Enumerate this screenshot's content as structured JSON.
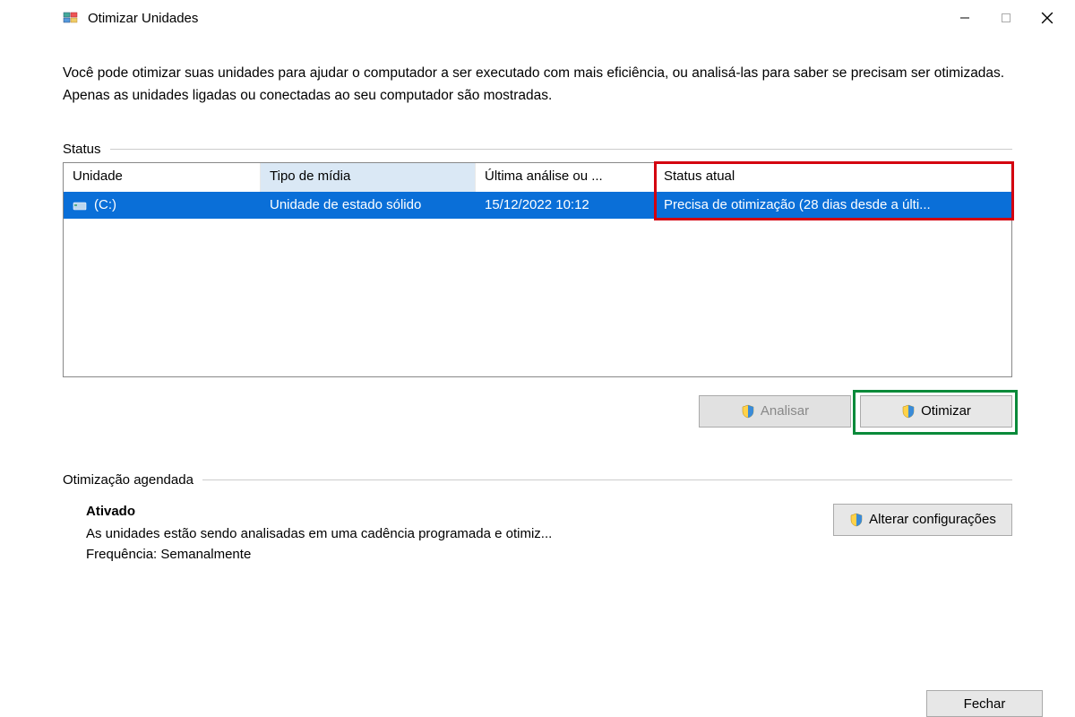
{
  "window": {
    "title": "Otimizar Unidades"
  },
  "description": "Você pode otimizar suas unidades para ajudar o computador a ser executado com mais eficiência, ou analisá-las para saber se precisam ser otimizadas. Apenas as unidades ligadas ou conectadas ao seu computador são mostradas.",
  "status_label": "Status",
  "columns": {
    "unit": "Unidade",
    "media": "Tipo de mídia",
    "last": "Última análise ou ...",
    "status": "Status atual"
  },
  "drive": {
    "name": "(C:)",
    "media": "Unidade de estado sólido",
    "last": "15/12/2022 10:12",
    "status": "Precisa de otimização (28 dias desde a últi..."
  },
  "buttons": {
    "analyze": "Analisar",
    "optimize": "Otimizar",
    "change_settings": "Alterar configurações",
    "close": "Fechar"
  },
  "schedule": {
    "section_label": "Otimização agendada",
    "state": "Ativado",
    "desc": "As unidades estão sendo analisadas em uma cadência programada e otimiz...",
    "freq_label": "Frequência:",
    "freq_value": "Semanalmente"
  }
}
